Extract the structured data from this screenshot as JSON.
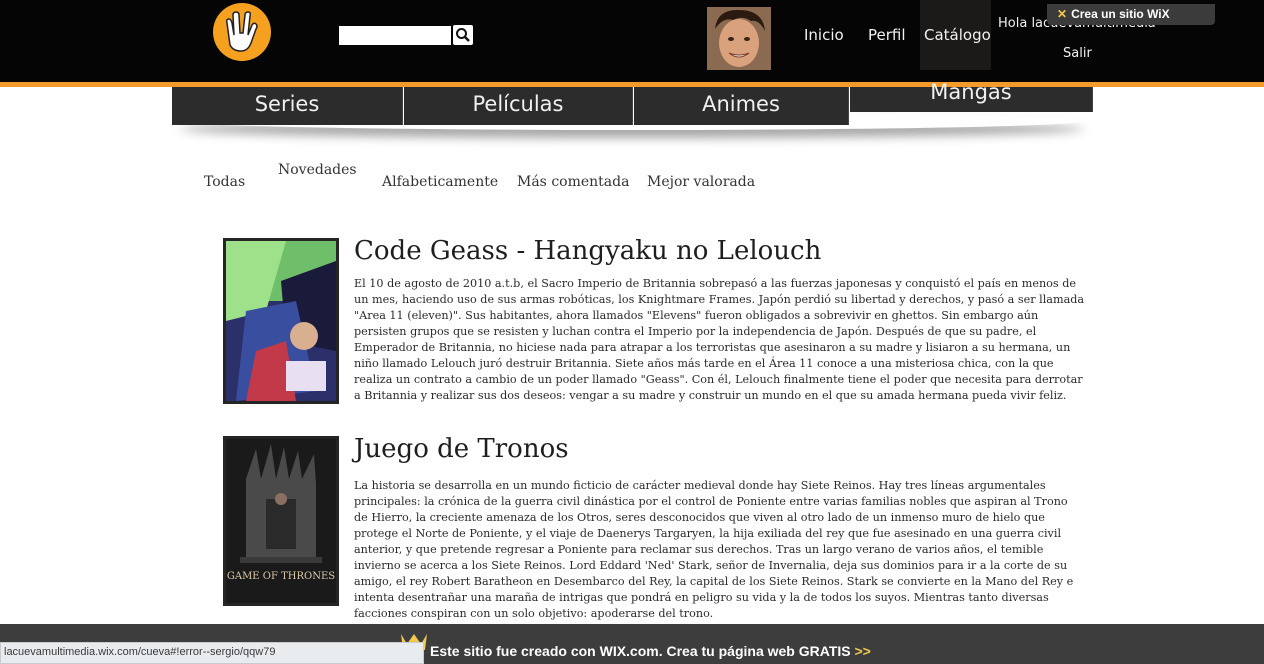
{
  "header": {
    "search_placeholder": "",
    "nav": [
      "Inicio",
      "Perfil",
      "Catálogo"
    ],
    "greeting": "Hola lacuevamultimedia",
    "logout": "Salir",
    "wix_tab": "Crea un sitio WiX",
    "accent_color": "#f39a2b"
  },
  "categories": [
    "Series",
    "Películas",
    "Animes",
    "Mangas"
  ],
  "filters": [
    "Todas",
    "Novedades",
    "Alfabeticamente",
    "Más comentada",
    "Mejor valorada"
  ],
  "items": [
    {
      "title": "Code Geass - Hangyaku no Lelouch",
      "description": "El 10 de agosto de 2010 a.t.b, el Sacro Imperio de Britannia sobrepasó a las fuerzas japonesas y conquistó el país en menos de un mes, haciendo uso de sus armas robóticas, los Knightmare Frames. Japón perdió su libertad y derechos, y pasó a ser llamada \"Area 11 (eleven)\". Sus habitantes, ahora llamados \"Elevens\" fueron obligados a sobrevivir en ghettos. Sin embargo aún persisten grupos que se resisten y luchan contra el Imperio por la independencia de Japón. Después de que su padre, el Emperador de Britannia, no hiciese nada para atrapar a los terroristas que asesinaron a su madre y lisiaron a su hermana, un niño llamado Lelouch juró destruir Britannia. Siete años más tarde en el Área 11 conoce a una misteriosa chica, con la que realiza un contrato a cambio de un poder llamado \"Geass\". Con él, Lelouch finalmente tiene el poder que necesita para derrotar a Britannia y realizar sus dos deseos: vengar a su madre y construir un mundo en el que su amada hermana pueda vivir feliz."
    },
    {
      "title": "Juego de Tronos",
      "description": "La historia se desarrolla en un mundo ficticio de carácter medieval donde hay Siete Reinos. Hay tres líneas argumentales principales: la crónica de la guerra civil dinástica por el control de Poniente entre varias familias nobles que aspiran al Trono de Hierro, la creciente amenaza de los Otros, seres desconocidos que viven al otro lado de un inmenso muro de hielo que protege el Norte de Poniente, y el viaje de Daenerys Targaryen, la hija exiliada del rey que fue asesinado en una guerra civil anterior, y que pretende regresar a Poniente para reclamar sus derechos. Tras un largo verano de varios años, el temible invierno se acerca a los Siete Reinos. Lord Eddard 'Ned' Stark, señor de Invernalia, deja sus dominios para ir a la corte de su amigo, el rey Robert Baratheon en Desembarco del Rey, la capital de los Siete Reinos. Stark se convierte en la Mano del Rey e intenta desentrañar una maraña de intrigas que pondrá en peligro su vida y la de todos los suyos. Mientras tanto diversas facciones conspiran con un solo objetivo: apoderarse del trono.",
      "poster_text": "GAME OF THRONES"
    }
  ],
  "wix_bar": {
    "text": "Este sitio fue creado con WIX.com. Crea tu página web GRATIS",
    "arrows": ">>"
  },
  "status_url": "lacuevamultimedia.wix.com/cueva#!error--sergio/qqw79"
}
